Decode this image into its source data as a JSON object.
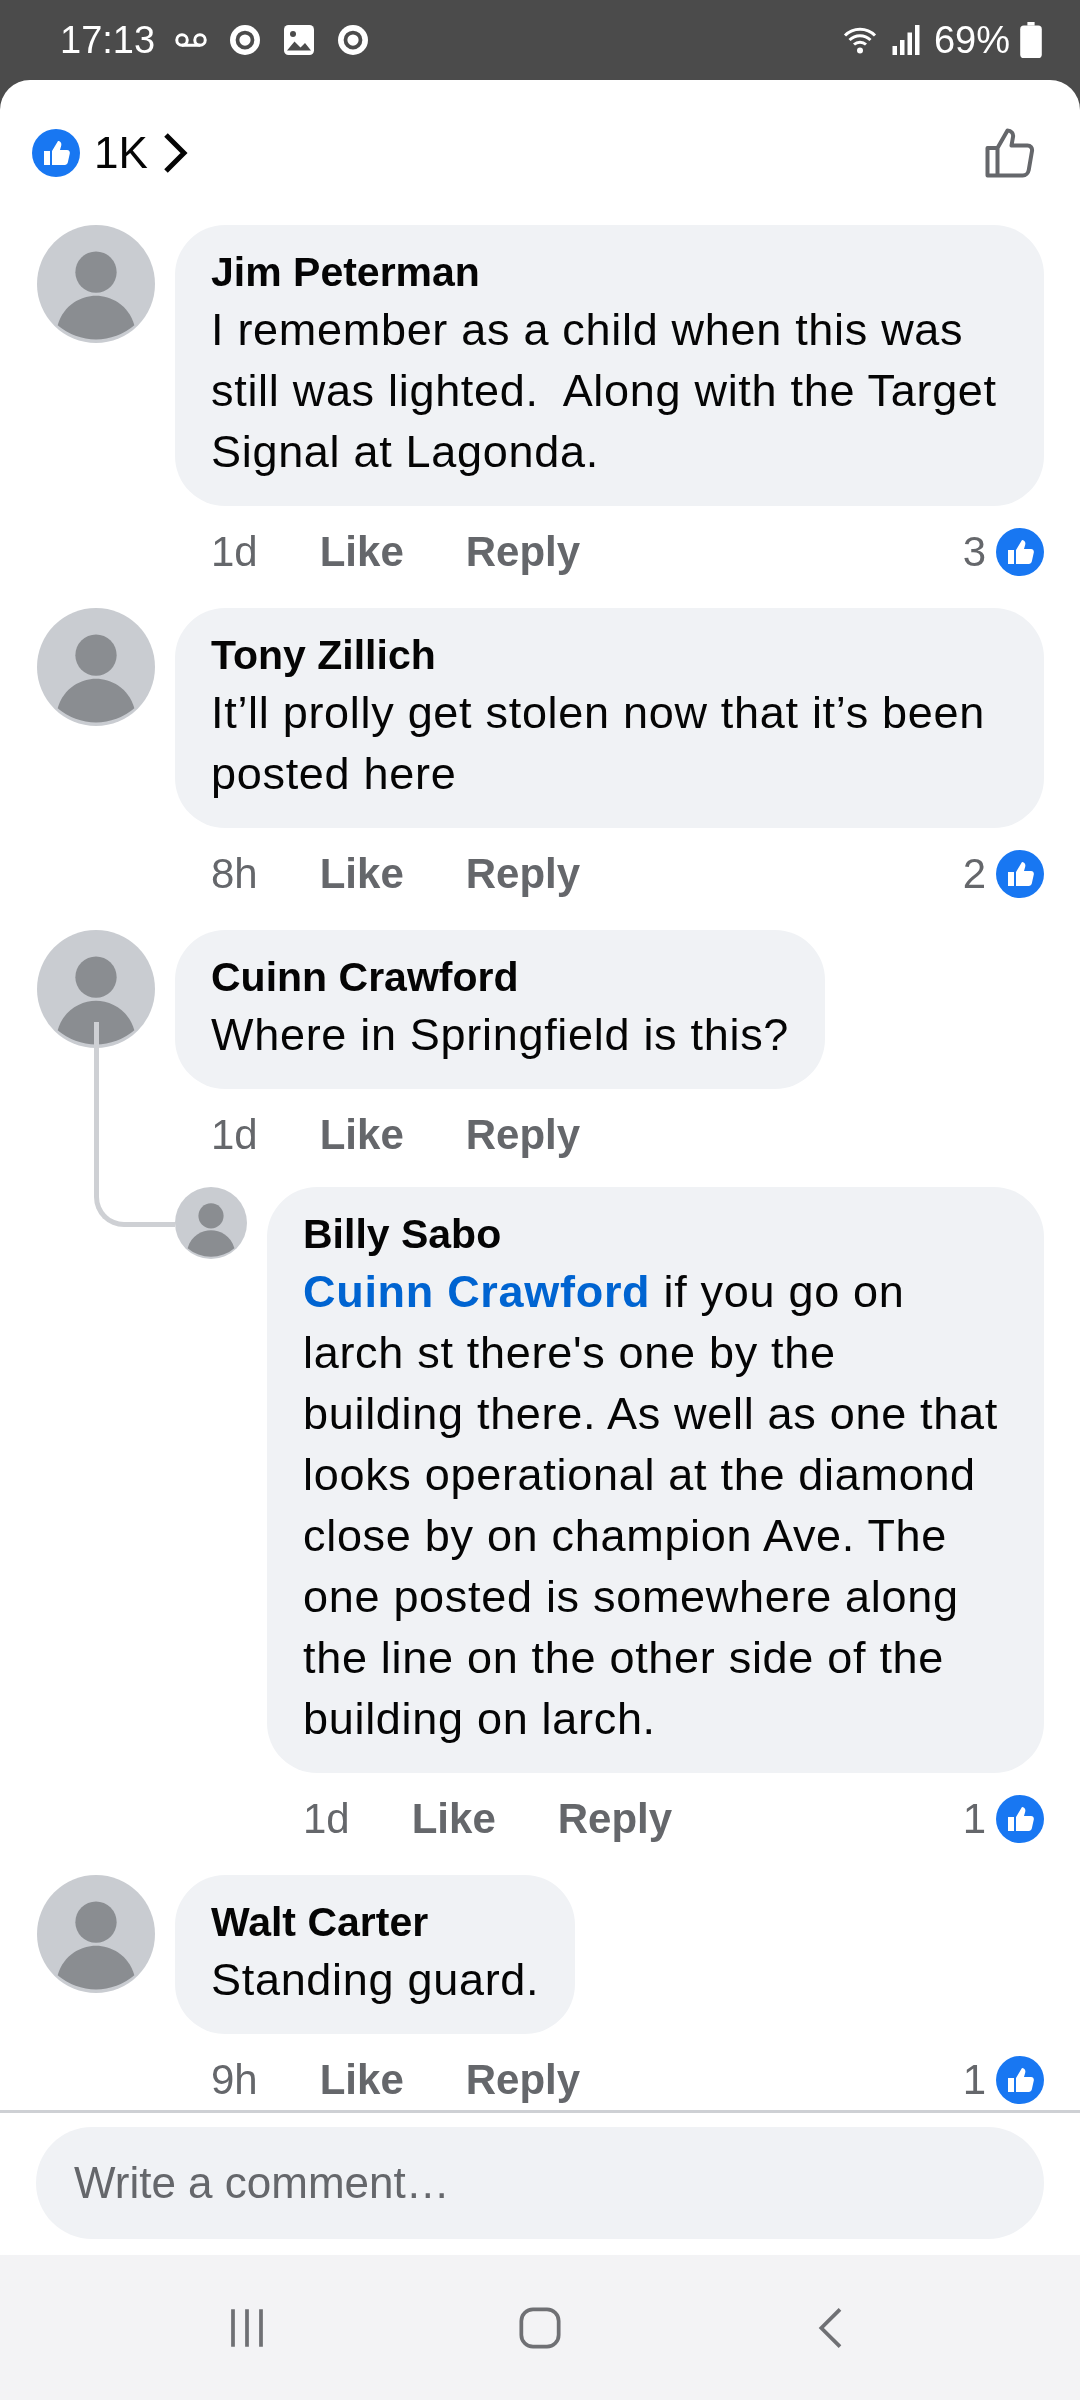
{
  "status_bar": {
    "time": "17:13",
    "battery": "69%"
  },
  "header": {
    "reaction_count": "1K"
  },
  "comments": [
    {
      "author": "Jim Peterman",
      "text": "I remember as a child when this was still was lighted.  Along with the Target Signal at Lagonda.",
      "time": "1d",
      "like": "Like",
      "reply": "Reply",
      "likes": "3"
    },
    {
      "author": "Tony Zillich",
      "text": "It’ll prolly get stolen now that it’s been posted here",
      "time": "8h",
      "like": "Like",
      "reply": "Reply",
      "likes": "2"
    },
    {
      "author": "Cuinn Crawford",
      "text": "Where in Springfield is this?",
      "time": "1d",
      "like": "Like",
      "reply": "Reply",
      "replies": [
        {
          "author": "Billy Sabo",
          "mention": "Cuinn Crawford",
          "text": "if you go on larch st there's one by the building there. As well as one that looks operational at the diamond close by on champion Ave. The one posted is somewhere along the line on the other side of the building on larch.",
          "time": "1d",
          "like": "Like",
          "reply": "Reply",
          "likes": "1"
        }
      ]
    },
    {
      "author": "Walt Carter",
      "text": "Standing guard.",
      "time": "9h",
      "like": "Like",
      "reply": "Reply",
      "likes": "1"
    }
  ],
  "composer": {
    "placeholder": "Write a comment…"
  }
}
